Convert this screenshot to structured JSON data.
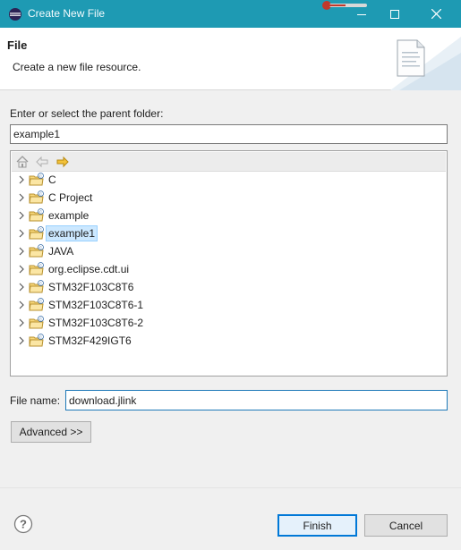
{
  "window": {
    "title": "Create New File"
  },
  "header": {
    "title": "File",
    "description": "Create a new file resource."
  },
  "parent_folder": {
    "label": "Enter or select the parent folder:",
    "value": "example1"
  },
  "tree": {
    "toolbar_icons": [
      "home-icon",
      "back-arrow-icon",
      "forward-arrow-icon"
    ],
    "items": [
      {
        "label": "C",
        "selected": false
      },
      {
        "label": "C Project",
        "selected": false
      },
      {
        "label": "example",
        "selected": false
      },
      {
        "label": "example1",
        "selected": true
      },
      {
        "label": "JAVA",
        "selected": false
      },
      {
        "label": "org.eclipse.cdt.ui",
        "selected": false
      },
      {
        "label": "STM32F103C8T6",
        "selected": false
      },
      {
        "label": "STM32F103C8T6-1",
        "selected": false
      },
      {
        "label": "STM32F103C8T6-2",
        "selected": false
      },
      {
        "label": "STM32F429IGT6",
        "selected": false
      }
    ]
  },
  "file_name": {
    "label": "File name:",
    "value": "download.jlink"
  },
  "buttons": {
    "advanced": "Advanced >>",
    "finish": "Finish",
    "cancel": "Cancel"
  },
  "colors": {
    "titlebar": "#1e9ab3",
    "selection": "#cce8ff",
    "default_button_border": "#0078d7"
  }
}
